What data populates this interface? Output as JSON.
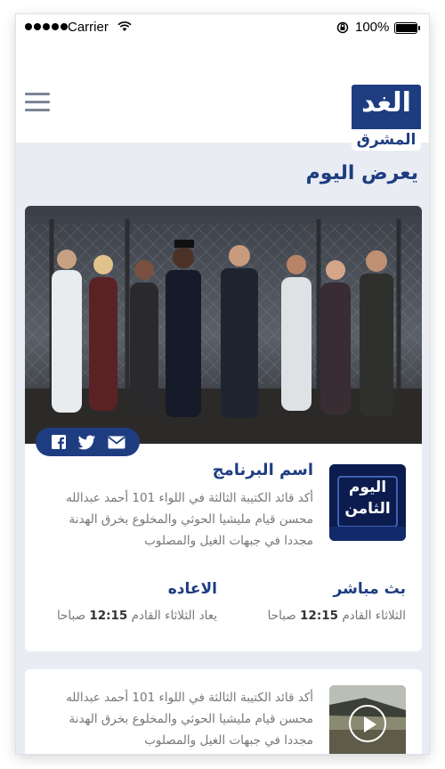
{
  "status_bar": {
    "carrier": "Carrier",
    "battery_percent": "100%",
    "battery_level": 1.0
  },
  "header": {
    "logo_main": "الغد",
    "logo_sub": "المشرق"
  },
  "section_title": "يعرض اليوم",
  "featured": {
    "share": [
      "facebook-icon",
      "twitter-icon",
      "mail-icon"
    ],
    "program_name": "اسم البرنامج",
    "description": "أكد قائد الكتيبة الثالثة في اللواء 101 أحمد عبدالله محسن قيام مليشيا الحوثي والمخلوع بخرق الهدنة مجددا في جبهات الغيل والمصلوب",
    "thumb_text": "اليوم الثامن",
    "live": {
      "label": "بث مباشر",
      "time_prefix": "الثلاثاء القادم",
      "time": "12:15",
      "time_suffix": "صباحا"
    },
    "rerun": {
      "label": "الاعاده",
      "time_prefix": "يعاد الثلاثاء القادم",
      "time": "12:15",
      "time_suffix": "صباحا"
    }
  },
  "second": {
    "description": "أكد قائد الكتيبة الثالثة في اللواء 101 أحمد عبدالله محسن قيام مليشيا الحوثي والمخلوع بخرق الهدنة مجددا في جبهات الغيل والمصلوب"
  },
  "colors": {
    "brand": "#1e3d81",
    "background": "#e9edf3",
    "muted_text": "#777777"
  }
}
